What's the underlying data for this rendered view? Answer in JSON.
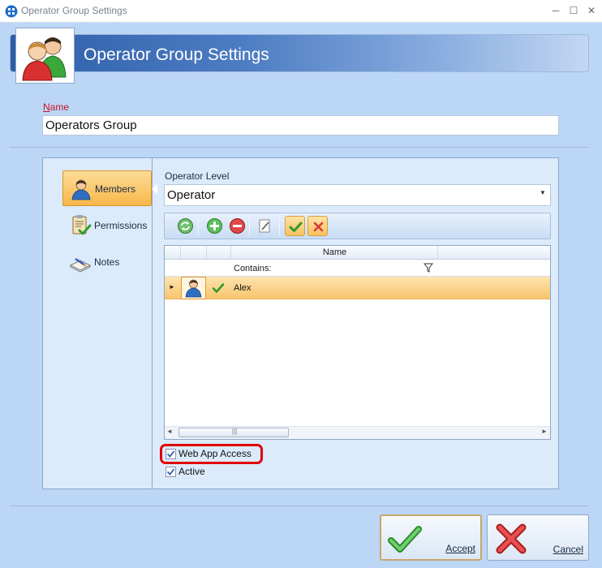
{
  "window": {
    "title": "Operator Group Settings",
    "minimize_label": "─",
    "maximize_label": "☐",
    "close_label": "✕"
  },
  "header": {
    "title": "Operator Group Settings",
    "icon": "operators-group-icon"
  },
  "name_field": {
    "label_first": "N",
    "label_rest": "ame",
    "value": "Operators Group"
  },
  "nav": {
    "items": [
      {
        "label": "Members",
        "icon": "member-user-icon",
        "selected": true
      },
      {
        "label": "Permissions",
        "icon": "permissions-clipboard-icon",
        "selected": false
      },
      {
        "label": "Notes",
        "icon": "notes-icon",
        "selected": false
      }
    ]
  },
  "operator_level": {
    "label": "Operator Level",
    "value": "Operator"
  },
  "toolbar": {
    "buttons": [
      "refresh-icon",
      "add-icon",
      "remove-icon",
      "edit-icon",
      "accept-check-icon",
      "reject-x-icon"
    ]
  },
  "grid": {
    "columns": [
      "Name"
    ],
    "filter": {
      "text": "Contains:",
      "icon": "filter-funnel-icon"
    },
    "rows": [
      {
        "indicator": "►",
        "avatar": "user-avatar-icon",
        "status": "check-icon",
        "name": "Alex",
        "selected": true
      }
    ],
    "hscroll": {
      "left": "◄",
      "right": "►",
      "grip": "|||"
    }
  },
  "checkboxes": {
    "web_app_access": {
      "label": "Web App Access",
      "checked": true,
      "highlighted": true
    },
    "active": {
      "label": "Active",
      "checked": true
    }
  },
  "buttons": {
    "accept": {
      "label_first": "A",
      "label_rest": "ccept",
      "icon": "green-check-icon"
    },
    "cancel": {
      "label_first": "C",
      "label_rest": "ancel",
      "icon": "red-x-icon"
    }
  },
  "colors": {
    "highlight": "#e00000",
    "selection": "#f9c56d",
    "banner": "#2e5ea8",
    "name_label": "#c6142d"
  }
}
